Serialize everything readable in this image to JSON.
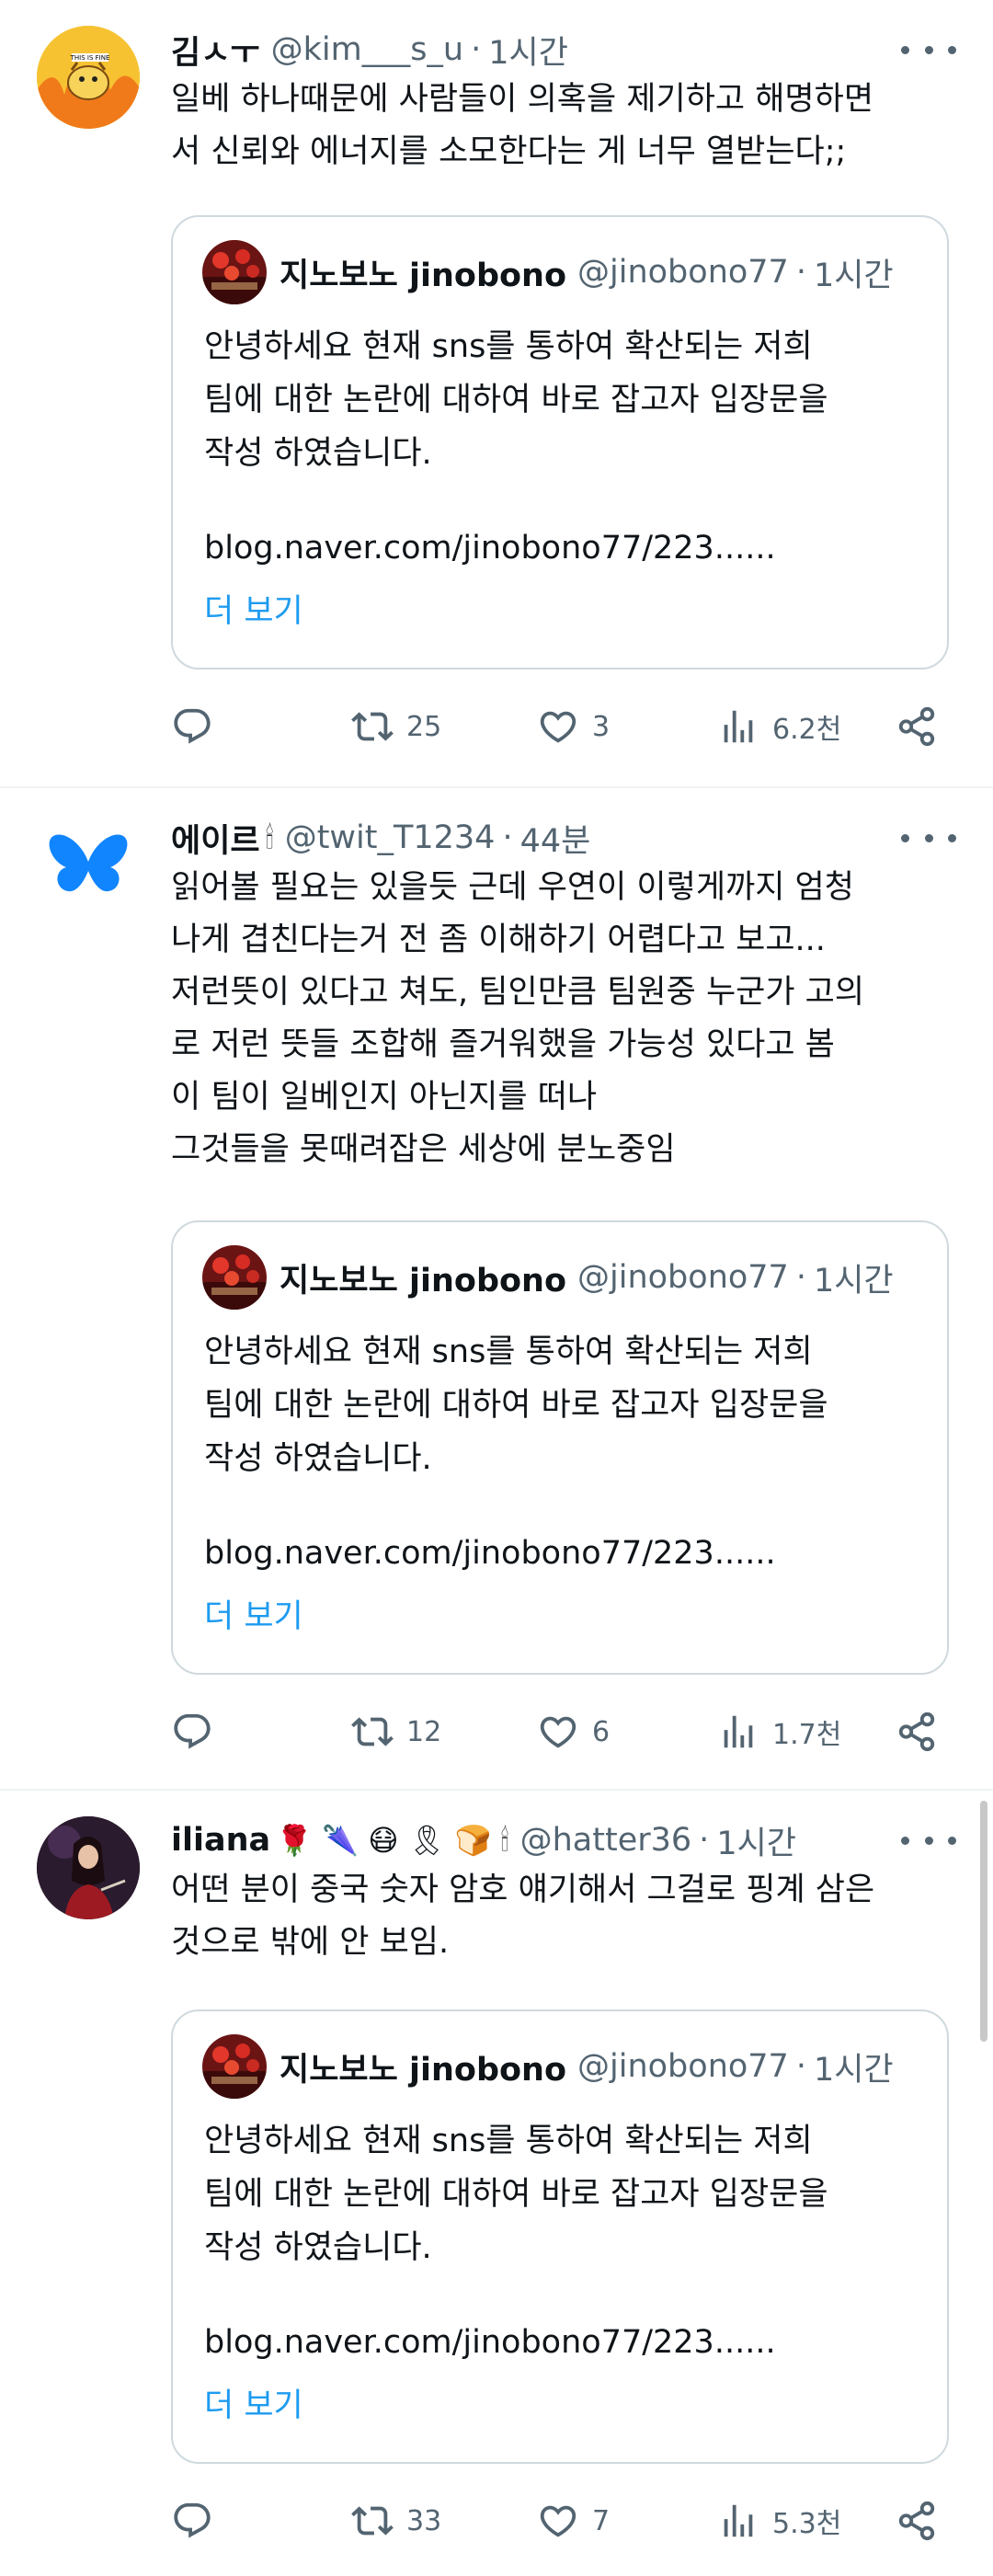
{
  "tweets": [
    {
      "name": "김ㅅㅜ",
      "name_emoji": "",
      "handle": "@kim___s_u",
      "time": "1시간",
      "text": "일베 하나때문에 사람들이 의혹을 제기하고 해명하면\n서 신뢰와 에너지를 소모한다는 게 너무 열받는다;;",
      "avatar_caption": "THIS IS FINE",
      "quote": {
        "name": "지노보노 jinobono",
        "handle": "@jinobono77",
        "time": "1시간",
        "text": "안녕하세요 현재 sns를 통하여 확산되는 저희\n팀에 대한 논란에 대하여 바로 잡고자 입장문을\n작성 하였습니다.",
        "link": "blog.naver.com/jinobono77/223......",
        "more": "더 보기"
      },
      "replies": "",
      "retweets": "25",
      "likes": "3",
      "views": "6.2천"
    },
    {
      "name": "에이르",
      "name_emoji": "🕯",
      "handle": "@twit_T1234",
      "time": "44분",
      "text": "읽어볼 필요는 있을듯 근데 우연이 이렇게까지 엄청\n나게 겹친다는거 전 좀 이해하기 어렵다고 보고...\n저런뜻이 있다고 쳐도, 팀인만큼 팀원중 누군가 고의\n로 저런 뜻들 조합해 즐거워했을 가능성 있다고 봄\n이 팀이 일베인지 아닌지를 떠나\n그것들을 못때려잡은 세상에 분노중임",
      "quote": {
        "name": "지노보노 jinobono",
        "handle": "@jinobono77",
        "time": "1시간",
        "text": "안녕하세요 현재 sns를 통하여 확산되는 저희\n팀에 대한 논란에 대하여 바로 잡고자 입장문을\n작성 하였습니다.",
        "link": "blog.naver.com/jinobono77/223......",
        "more": "더 보기"
      },
      "replies": "",
      "retweets": "12",
      "likes": "6",
      "views": "1.7천"
    },
    {
      "name": "iliana",
      "name_emoji": "🌹 🌂 😷 🎗 🍞 🕯",
      "handle": "@hatter36",
      "time": "1시간",
      "text": "어떤 분이 중국 숫자 암호 얘기해서 그걸로 핑계 삼은\n것으로 밖에 안 보임.",
      "quote": {
        "name": "지노보노 jinobono",
        "handle": "@jinobono77",
        "time": "1시간",
        "text": "안녕하세요 현재 sns를 통하여 확산되는 저희\n팀에 대한 논란에 대하여 바로 잡고자 입장문을\n작성 하였습니다.",
        "link": "blog.naver.com/jinobono77/223......",
        "more": "더 보기"
      },
      "replies": "",
      "retweets": "33",
      "likes": "7",
      "views": "5.3천"
    }
  ],
  "colors": {
    "text": "#0f1419",
    "secondary": "#536471",
    "link": "#1d9bf0",
    "border": "#cfd9de",
    "divider": "#eff3f4",
    "butterfly": "#1185fe"
  }
}
